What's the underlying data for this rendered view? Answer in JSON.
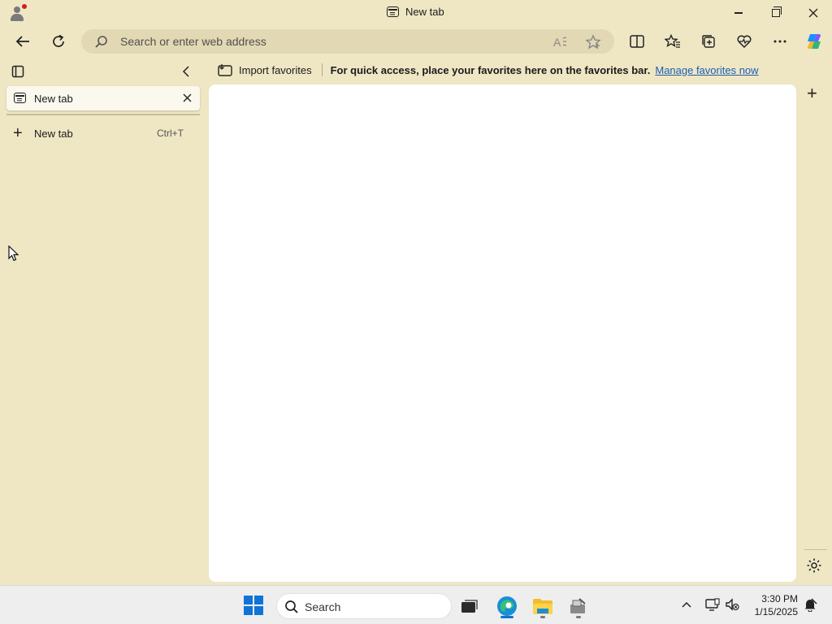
{
  "window": {
    "title": "New tab"
  },
  "toolbar": {
    "address_placeholder": "Search or enter web address"
  },
  "favorites_bar": {
    "import_label": "Import favorites",
    "message": "For quick access, place your favorites here on the favorites bar.",
    "manage_link": "Manage favorites now"
  },
  "vertical_tabs": {
    "tabs": [
      {
        "label": "New tab"
      }
    ],
    "new_tab_label": "New tab",
    "new_tab_shortcut": "Ctrl+T"
  },
  "taskbar": {
    "search_label": "Search",
    "time": "3:30 PM",
    "date": "1/15/2025"
  },
  "colors": {
    "frame": "#efe6c4",
    "address_bg": "#e2d8b3",
    "link": "#1a5fb4",
    "accent": "#0f74d8"
  }
}
